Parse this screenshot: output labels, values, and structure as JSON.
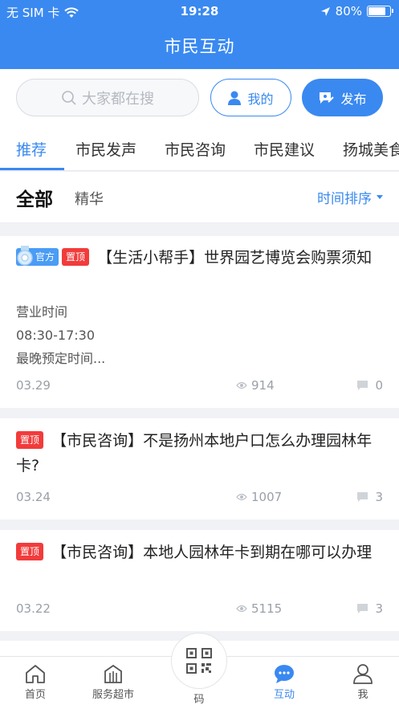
{
  "status_bar": {
    "carrier": "无 SIM 卡",
    "time": "19:28",
    "battery": "80%",
    "battery_level": 0.8
  },
  "header": {
    "title": "市民互动"
  },
  "search": {
    "placeholder": "大家都在搜"
  },
  "actions": {
    "mine_label": "我的",
    "post_label": "发布"
  },
  "tabs": [
    {
      "label": "推荐",
      "active": true
    },
    {
      "label": "市民发声"
    },
    {
      "label": "市民咨询"
    },
    {
      "label": "市民建议"
    },
    {
      "label": "扬城美食"
    }
  ],
  "filter": {
    "all_label": "全部",
    "best_label": "精华",
    "sort_label": "时间排序"
  },
  "posts": [
    {
      "badges": [
        "官方",
        "置顶"
      ],
      "title": "【生活小帮手】世界园艺博览会购票须知",
      "excerpt": [
        "营业时间",
        "08:30-17:30",
        "最晚预定时间..."
      ],
      "date": "03.29",
      "views": "914",
      "comments": "0"
    },
    {
      "badges": [
        "置顶"
      ],
      "title": "【市民咨询】不是扬州本地户口怎么办理园林年卡?",
      "date": "03.24",
      "views": "1007",
      "comments": "3"
    },
    {
      "badges": [
        "置顶"
      ],
      "title": "【市民咨询】本地人园林年卡到期在哪可以办理",
      "date": "03.22",
      "views": "5115",
      "comments": "3"
    }
  ],
  "tabbar": [
    {
      "label": "首页",
      "icon": "home-icon"
    },
    {
      "label": "服务超市",
      "icon": "building-icon"
    },
    {
      "label": "码",
      "icon": "qr-code-icon"
    },
    {
      "label": "互动",
      "icon": "chat-bubble-icon",
      "active": true
    },
    {
      "label": "我",
      "icon": "person-icon"
    }
  ],
  "colors": {
    "accent": "#3a89f0",
    "badge_top": "#f23b3b",
    "badge_official": "#4a9cf5"
  }
}
